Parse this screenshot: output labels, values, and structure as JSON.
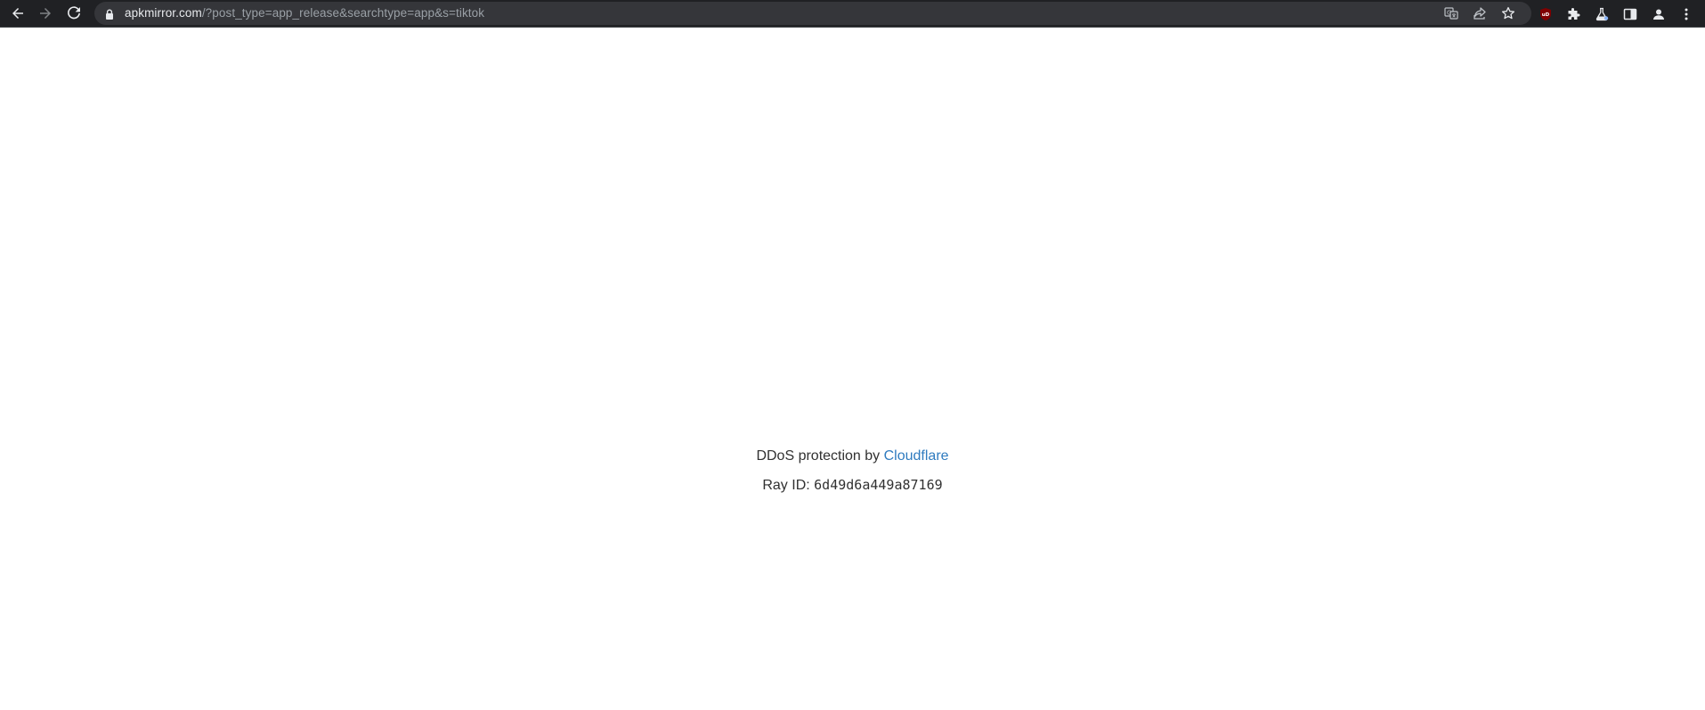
{
  "browser": {
    "url_host": "apkmirror.com",
    "url_path": "/?post_type=app_release&searchtype=app&s=tiktok",
    "icons": {
      "back": "arrow-left-icon",
      "forward": "arrow-right-icon",
      "reload": "reload-icon",
      "lock": "lock-icon",
      "translate": "translate-icon",
      "share": "share-icon",
      "bookmark": "star-icon",
      "ublock": "ublock-origin-icon",
      "extensions": "puzzle-icon",
      "labs": "flask-icon",
      "side_panel": "side-panel-icon",
      "profile": "profile-icon",
      "menu": "kebab-menu-icon"
    },
    "ublock_badge": "uD",
    "colors": {
      "toolbar_bg": "#202124",
      "omnibox_bg": "#35363a",
      "ublock_red": "#800000"
    }
  },
  "page": {
    "protection_prefix": "DDoS protection by ",
    "protection_link": "Cloudflare",
    "ray_label": "Ray ID: ",
    "ray_id": "6d49d6a449a87169",
    "colors": {
      "text": "#313131",
      "link": "#2f7bbf",
      "background": "#ffffff"
    }
  }
}
